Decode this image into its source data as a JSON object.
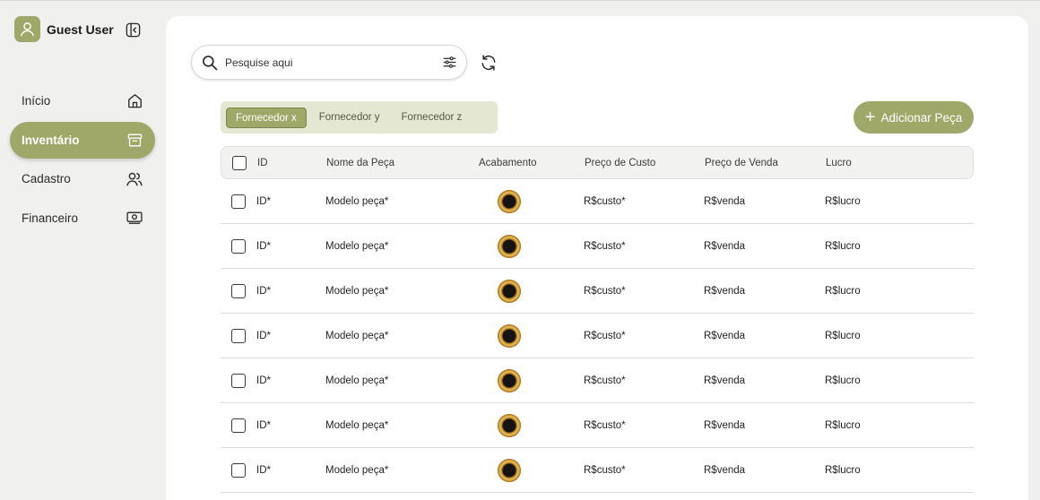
{
  "sidebar": {
    "user_name": "Guest User",
    "items": [
      {
        "label": "Início",
        "icon": "home-icon",
        "active": false
      },
      {
        "label": "Inventário",
        "icon": "archive-icon",
        "active": true
      },
      {
        "label": "Cadastro",
        "icon": "users-icon",
        "active": false
      },
      {
        "label": "Financeiro",
        "icon": "money-icon",
        "active": false
      }
    ]
  },
  "toolbar": {
    "search_placeholder": "Pesquise aqui",
    "add_label": "Adicionar Peça"
  },
  "supplier_tabs": [
    "Fornecedor x",
    "Fornecedor y",
    "Fornecedor z"
  ],
  "active_supplier": "Fornecedor x",
  "table": {
    "headers": [
      "ID",
      "Nome da Peça",
      "Acabamento",
      "Preço de Custo",
      "Preço de Venda",
      "Lucro"
    ],
    "rows": [
      {
        "id": "ID*",
        "name": "Modelo peça*",
        "cost": "R$custo*",
        "sale": "R$venda",
        "profit": "R$lucro"
      },
      {
        "id": "ID*",
        "name": "Modelo peça*",
        "cost": "R$custo*",
        "sale": "R$venda",
        "profit": "R$lucro"
      },
      {
        "id": "ID*",
        "name": "Modelo peça*",
        "cost": "R$custo*",
        "sale": "R$venda",
        "profit": "R$lucro"
      },
      {
        "id": "ID*",
        "name": "Modelo peça*",
        "cost": "R$custo*",
        "sale": "R$venda",
        "profit": "R$lucro"
      },
      {
        "id": "ID*",
        "name": "Modelo peça*",
        "cost": "R$custo*",
        "sale": "R$venda",
        "profit": "R$lucro"
      },
      {
        "id": "ID*",
        "name": "Modelo peça*",
        "cost": "R$custo*",
        "sale": "R$venda",
        "profit": "R$lucro"
      },
      {
        "id": "ID*",
        "name": "Modelo peça*",
        "cost": "R$custo*",
        "sale": "R$venda",
        "profit": "R$lucro"
      }
    ]
  },
  "colors": {
    "accent": "#9fa868",
    "tab_bg": "#e4e7d2",
    "page_bg": "#f0f0ef"
  }
}
